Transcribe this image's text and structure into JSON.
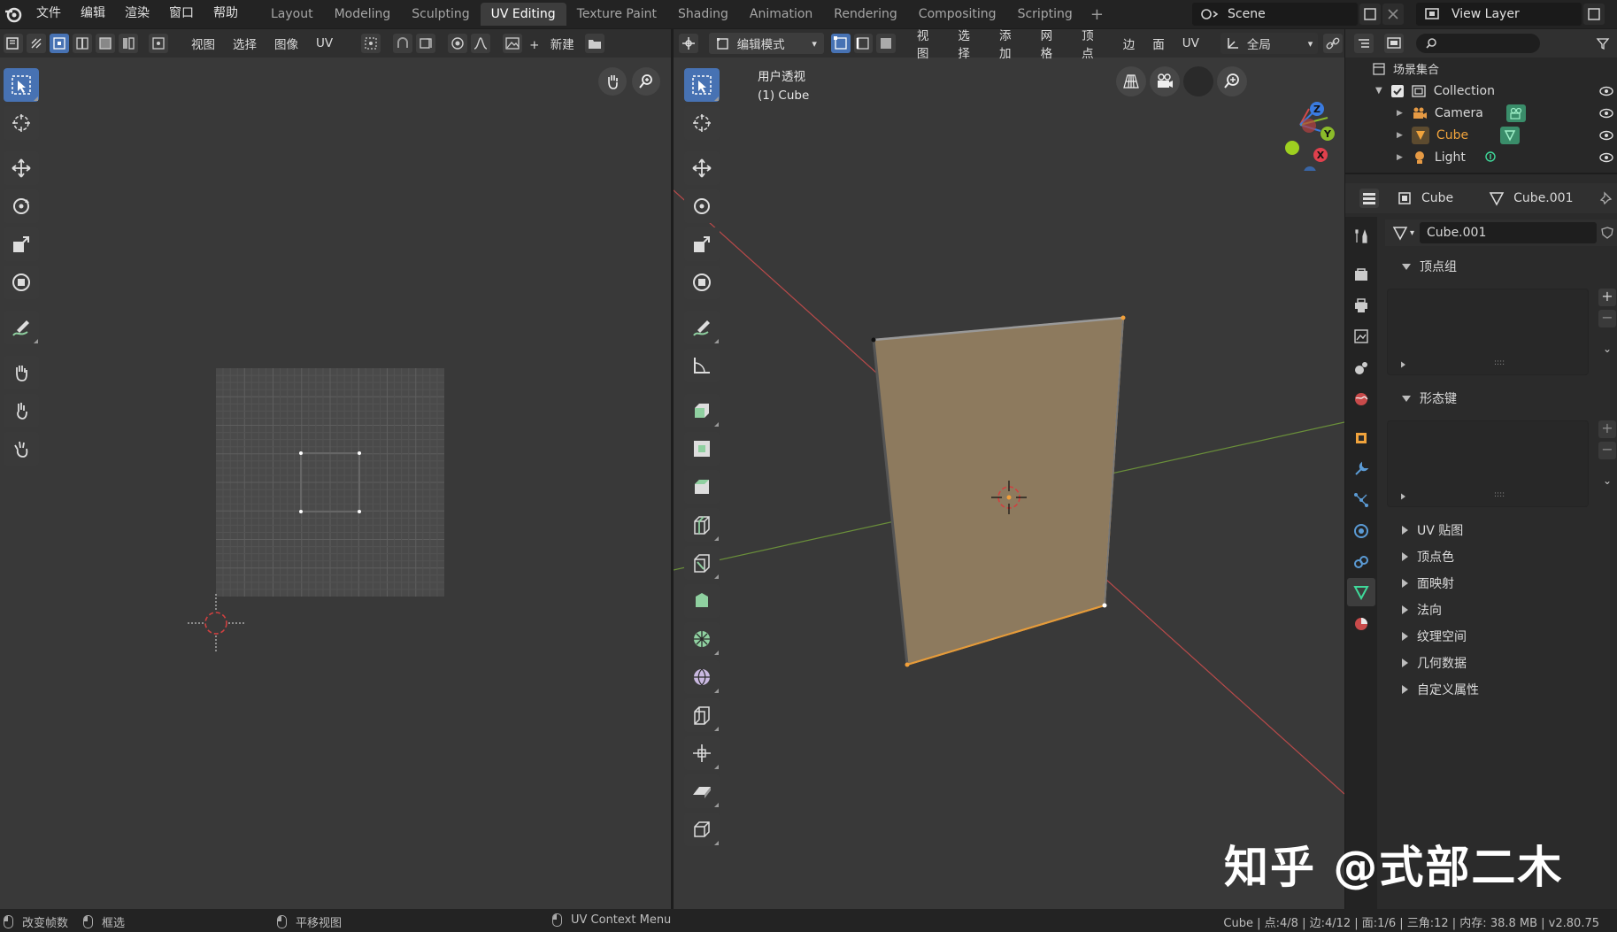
{
  "topbar": {
    "menus": [
      "文件",
      "编辑",
      "渲染",
      "窗口",
      "帮助"
    ],
    "workspace_tabs": [
      "Layout",
      "Modeling",
      "Sculpting",
      "UV Editing",
      "Texture Paint",
      "Shading",
      "Animation",
      "Rendering",
      "Compositing",
      "Scripting"
    ],
    "active_tab": "UV Editing",
    "add_tab_symbol": "+",
    "scene_name": "Scene",
    "view_layer_name": "View Layer"
  },
  "uv_editor": {
    "header_menus": [
      "视图",
      "选择",
      "图像",
      "UV"
    ],
    "new_label": "新建",
    "new_symbol": "+"
  },
  "viewport": {
    "mode": "编辑模式",
    "header_menus": [
      "视图",
      "选择",
      "添加",
      "网格",
      "顶点",
      "边",
      "面",
      "UV"
    ],
    "orientation": "全局",
    "overlay_text": "用户透视",
    "object_text": "(1) Cube",
    "gizmo_axes": {
      "x": "X",
      "y": "Y",
      "z": "Z"
    },
    "colors": {
      "face": "#8d7a5e",
      "face_outline": "#e59b3a",
      "x_axis": "#b94a4a",
      "y_axis": "#6a8f3a"
    }
  },
  "outliner": {
    "scene_collection": "场景集合",
    "collection": "Collection",
    "items": [
      {
        "name": "Camera",
        "icon": "camera-icon",
        "color": "#d8d8d8"
      },
      {
        "name": "Cube",
        "icon": "mesh-icon",
        "color": "#f0a33c"
      },
      {
        "name": "Light",
        "icon": "light-icon",
        "color": "#d8d8d8"
      }
    ]
  },
  "properties": {
    "object_name": "Cube",
    "mesh_name": "Cube.001",
    "data_field_value": "Cube.001",
    "sections": {
      "vertex_groups": "顶点组",
      "shape_keys": "形态键",
      "uv_maps": "UV 贴图",
      "vertex_colors": "顶点色",
      "face_maps": "面映射",
      "normals": "法向",
      "texture_space": "纹理空间",
      "geometry_data": "几何数据",
      "custom_properties": "自定义属性"
    },
    "list_grip": "::::"
  },
  "statusbar": {
    "change_frame": "改变帧数",
    "box_select": "框选",
    "pan_view": "平移视图",
    "uv_context_menu": "UV Context Menu",
    "stats": "Cube | 点:4/8 | 边:4/12 | 面:1/6 | 三角:12 | 内存: 38.8 MB | v2.80.75"
  },
  "watermark": "知乎 @式部二木"
}
